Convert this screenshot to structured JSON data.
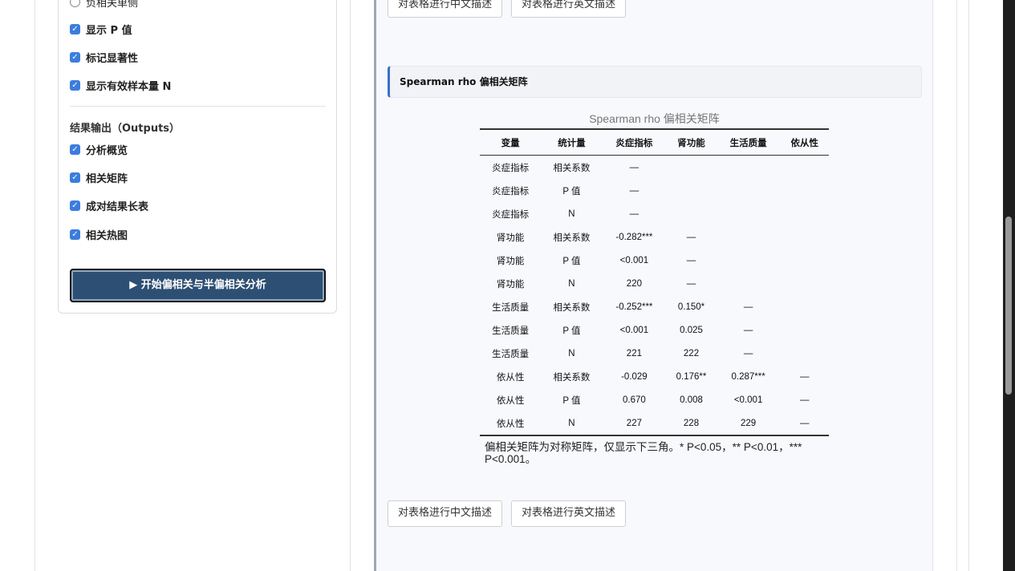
{
  "left_panel": {
    "partial_option": "负相关单侧",
    "options": [
      {
        "label": "显示 P 值",
        "checked": true
      },
      {
        "label": "标记显著性",
        "checked": true
      },
      {
        "label": "显示有效样本量 N",
        "checked": true
      }
    ],
    "outputs_title": "结果输出（Outputs）",
    "outputs": [
      {
        "label": "分析概览",
        "checked": true
      },
      {
        "label": "相关矩阵",
        "checked": true
      },
      {
        "label": "成对结果长表",
        "checked": true
      },
      {
        "label": "相关热图",
        "checked": true
      }
    ],
    "run_button": "▶ 开始偏相关与半偏相关分析"
  },
  "content": {
    "top_buttons": [
      "对表格进行中文描述",
      "对表格进行英文描述"
    ],
    "section_title": "Spearman rho 偏相关矩阵",
    "table": {
      "caption": "Spearman rho 偏相关矩阵",
      "headers": [
        "变量",
        "统计量",
        "炎症指标",
        "肾功能",
        "生活质量",
        "依从性"
      ],
      "rows": [
        [
          "炎症指标",
          "相关系数",
          "—",
          "",
          "",
          ""
        ],
        [
          "炎症指标",
          "P 值",
          "—",
          "",
          "",
          ""
        ],
        [
          "炎症指标",
          "N",
          "—",
          "",
          "",
          ""
        ],
        [
          "肾功能",
          "相关系数",
          "-0.282***",
          "—",
          "",
          ""
        ],
        [
          "肾功能",
          "P 值",
          "<0.001",
          "—",
          "",
          ""
        ],
        [
          "肾功能",
          "N",
          "220",
          "—",
          "",
          ""
        ],
        [
          "生活质量",
          "相关系数",
          "-0.252***",
          "0.150*",
          "—",
          ""
        ],
        [
          "生活质量",
          "P 值",
          "<0.001",
          "0.025",
          "—",
          ""
        ],
        [
          "生活质量",
          "N",
          "221",
          "222",
          "—",
          ""
        ],
        [
          "依从性",
          "相关系数",
          "-0.029",
          "0.176**",
          "0.287***",
          "—"
        ],
        [
          "依从性",
          "P 值",
          "0.670",
          "0.008",
          "<0.001",
          "—"
        ],
        [
          "依从性",
          "N",
          "227",
          "228",
          "229",
          "—"
        ]
      ],
      "note": "偏相关矩阵为对称矩阵，仅显示下三角。* P<0.05，** P<0.01，*** P<0.001。"
    },
    "bottom_buttons": [
      "对表格进行中文描述",
      "对表格进行英文描述"
    ]
  },
  "colors": {
    "accent": "#3b6fd0",
    "run_button": "#2d4f73",
    "checkbox": "#3b7ddd"
  }
}
